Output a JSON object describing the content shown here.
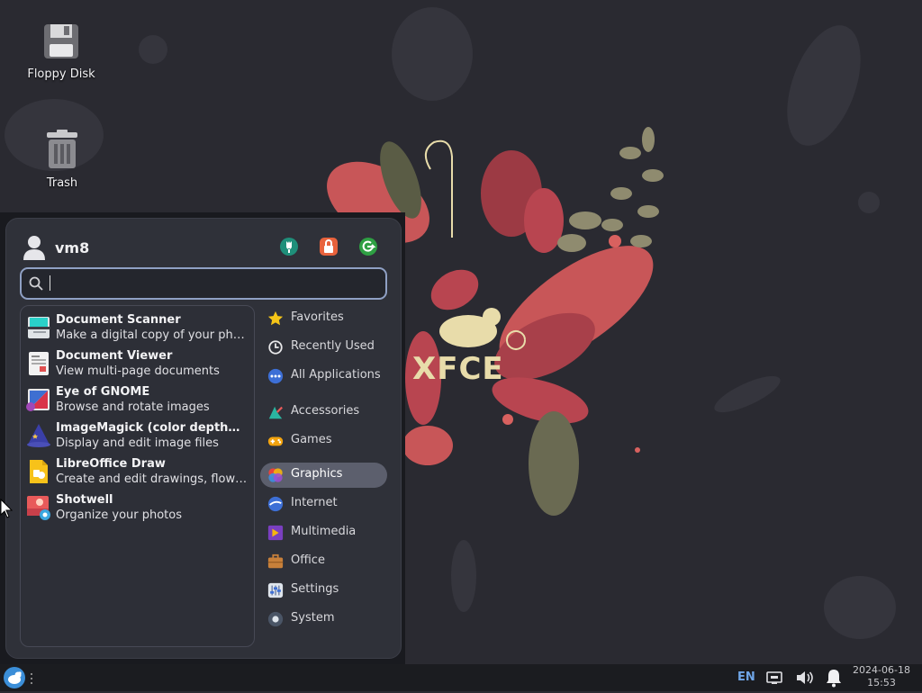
{
  "desktop": {
    "icons": [
      {
        "label": "Floppy Disk",
        "icon": "floppy-disk-icon"
      },
      {
        "label": "Trash",
        "icon": "trash-icon"
      }
    ],
    "wallpaper_logo": "XFCE"
  },
  "menu": {
    "username": "vm8",
    "header_buttons": [
      "settings-manager-icon",
      "lock-screen-icon",
      "logout-icon"
    ],
    "search": {
      "value": "",
      "placeholder": ""
    },
    "apps": [
      {
        "name": "Document Scanner",
        "desc": "Make a digital copy of your ph…"
      },
      {
        "name": "Document Viewer",
        "desc": "View multi-page documents"
      },
      {
        "name": "Eye of GNOME",
        "desc": "Browse and rotate images"
      },
      {
        "name": "ImageMagick (color depth…",
        "desc": "Display and edit image files"
      },
      {
        "name": "LibreOffice Draw",
        "desc": "Create and edit drawings, flow…"
      },
      {
        "name": "Shotwell",
        "desc": "Organize your photos"
      }
    ],
    "categories": [
      {
        "label": "Favorites",
        "icon": "star-icon"
      },
      {
        "label": "Recently Used",
        "icon": "clock-icon"
      },
      {
        "label": "All Applications",
        "icon": "all-apps-icon"
      },
      {
        "label": "Accessories",
        "icon": "accessories-icon"
      },
      {
        "label": "Games",
        "icon": "gamepad-icon"
      },
      {
        "label": "Graphics",
        "icon": "graphics-icon",
        "selected": true
      },
      {
        "label": "Internet",
        "icon": "globe-icon"
      },
      {
        "label": "Multimedia",
        "icon": "multimedia-icon"
      },
      {
        "label": "Office",
        "icon": "briefcase-icon"
      },
      {
        "label": "Settings",
        "icon": "sliders-icon"
      },
      {
        "label": "System",
        "icon": "system-icon"
      }
    ]
  },
  "panel": {
    "keyboard_layout": "EN",
    "date": "2024-06-18",
    "time": "15:53"
  },
  "colors": {
    "desktop_bg": "#2a2a31",
    "menu_bg": "#2f3139",
    "selected_category_bg": "#5c5f6d",
    "search_border": "#8fa0c4",
    "accent_lang": "#6fa6e8"
  }
}
